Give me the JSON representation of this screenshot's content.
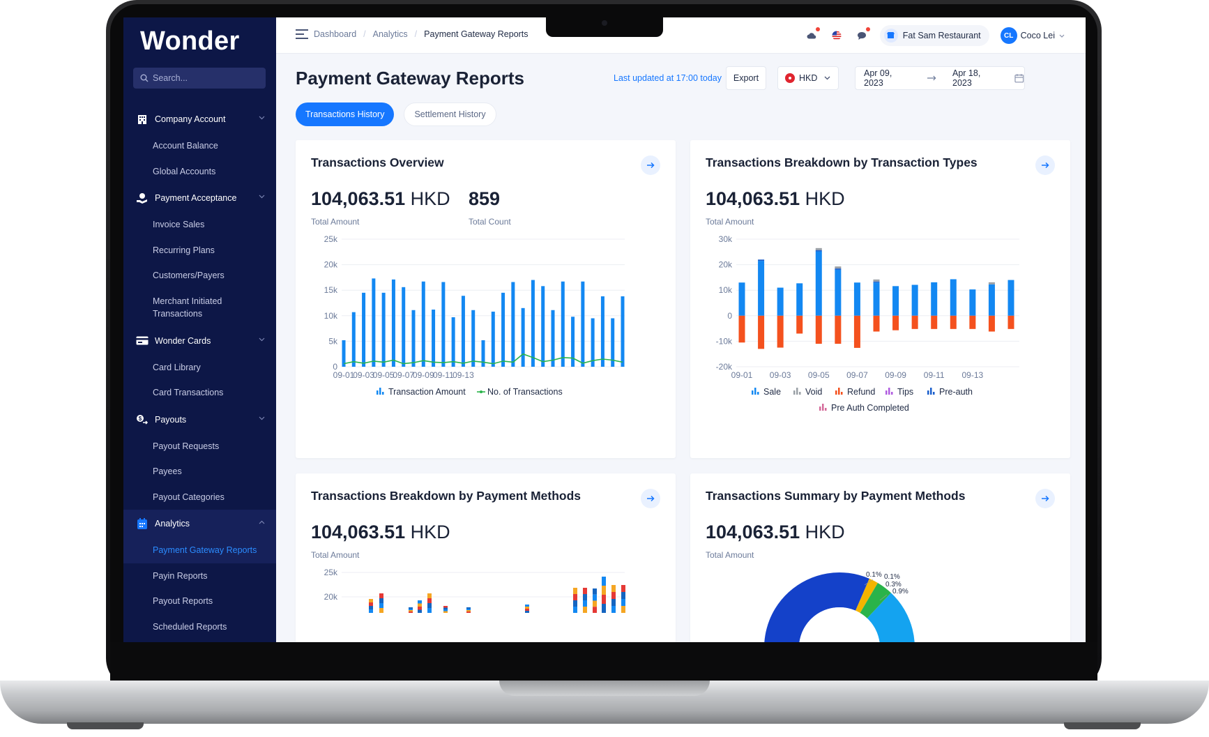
{
  "app": {
    "logo": "Wonder",
    "search_placeholder": "Search..."
  },
  "sidebar": {
    "sections": [
      {
        "label": "Company Account",
        "icon": "building-icon",
        "items": [
          "Account Balance",
          "Global Accounts"
        ]
      },
      {
        "label": "Payment Acceptance",
        "icon": "hand-payment-icon",
        "items": [
          "Invoice Sales",
          "Recurring Plans",
          "Customers/Payers",
          "Merchant Initiated Transactions"
        ]
      },
      {
        "label": "Wonder Cards",
        "icon": "card-icon",
        "items": [
          "Card Library",
          "Card Transactions"
        ]
      },
      {
        "label": "Payouts",
        "icon": "payout-icon",
        "items": [
          "Payout Requests",
          "Payees",
          "Payout Categories"
        ]
      },
      {
        "label": "Analytics",
        "icon": "analytics-icon",
        "items": [
          "Payment Gateway Reports",
          "Payin Reports",
          "Payout Reports",
          "Scheduled Reports"
        ]
      }
    ],
    "active_item": "Payment Gateway Reports"
  },
  "topbar": {
    "breadcrumbs": [
      "Dashboard",
      "Analytics",
      "Payment Gateway Reports"
    ],
    "store": "Fat Sam Restaurant",
    "user_initials": "CL",
    "user_name": "Coco Lei"
  },
  "page": {
    "title": "Payment Gateway Reports",
    "last_updated": "Last updated at 17:00 today",
    "export_label": "Export",
    "currency": "HKD",
    "date_from": "Apr 09, 2023",
    "date_to": "Apr 18, 2023",
    "tabs": [
      {
        "label": "Transactions History",
        "active": true
      },
      {
        "label": "Settlement History",
        "active": false
      }
    ]
  },
  "cards": {
    "overview": {
      "title": "Transactions Overview",
      "amount": "104,063.51",
      "currency": "HKD",
      "amount_label": "Total Amount",
      "count": "859",
      "count_label": "Total Count"
    },
    "types": {
      "title": "Transactions Breakdown by Transaction Types",
      "amount": "104,063.51",
      "currency": "HKD",
      "amount_label": "Total Amount"
    },
    "methods": {
      "title": "Transactions Breakdown by Payment Methods",
      "amount": "104,063.51",
      "currency": "HKD",
      "amount_label": "Total Amount"
    },
    "summary": {
      "title": "Transactions Summary by Payment Methods",
      "amount": "104,063.51",
      "currency": "HKD",
      "amount_label": "Total Amount"
    }
  },
  "colors": {
    "accent": "#1677ff",
    "sidebar": "#0d1747",
    "sale": "#1388f2",
    "void": "#9aa0a6",
    "refund": "#f4511e",
    "tips": "#b05ce0",
    "preauth": "#1b5fcc",
    "preauth_completed": "#d46a9a",
    "line": "#2ab34a"
  },
  "chart_data": [
    {
      "type": "bar",
      "title": "Transactions Overview",
      "x_ticks": [
        "09-01",
        "09-03",
        "09-05",
        "09-07",
        "09-09",
        "09-11",
        "09-13"
      ],
      "ylim": [
        0,
        25000
      ],
      "y_ticks": [
        "0",
        "5k",
        "10k",
        "15k",
        "20k",
        "25k"
      ],
      "series": [
        {
          "name": "Transaction Amount",
          "kind": "bar",
          "values": [
            5200,
            10700,
            14500,
            17300,
            14500,
            17100,
            15600,
            11100,
            16700,
            11200,
            16600,
            9700,
            13900,
            11100,
            5200,
            10800,
            14500,
            16600,
            11500,
            17000,
            15800,
            11100,
            16700,
            9800,
            16700,
            9500,
            13800,
            9500,
            13800
          ]
        },
        {
          "name": "No. of Transactions",
          "kind": "line",
          "values": [
            600,
            1000,
            700,
            1100,
            900,
            1300,
            600,
            800,
            1200,
            900,
            800,
            1000,
            700,
            1100,
            900,
            600,
            1100,
            900,
            2500,
            1800,
            1000,
            1300,
            1800,
            1700,
            700,
            1200,
            1500,
            1300,
            900
          ]
        }
      ],
      "legend": "bottom"
    },
    {
      "type": "bar",
      "title": "Transactions Breakdown by Transaction Types",
      "x_ticks": [
        "09-01",
        "09-03",
        "09-05",
        "09-07",
        "09-09",
        "09-11",
        "09-13"
      ],
      "ylim": [
        -20000,
        30000
      ],
      "y_ticks": [
        "-20k",
        "-10k",
        "0",
        "10k",
        "20k",
        "30k"
      ],
      "series": [
        {
          "name": "Sale",
          "values": [
            13000,
            21500,
            11000,
            12700,
            25200,
            18000,
            13000,
            13000,
            11600,
            12100,
            13100,
            14300,
            10300,
            12300,
            14000
          ]
        },
        {
          "name": "Void",
          "values": [
            0,
            0,
            0,
            0,
            800,
            800,
            0,
            800,
            0,
            0,
            0,
            0,
            0,
            800,
            0
          ]
        },
        {
          "name": "Refund",
          "values": [
            -10500,
            -13000,
            -12500,
            -7000,
            -11000,
            -11000,
            -12600,
            -6200,
            -5700,
            -5200,
            -5200,
            -5200,
            -5200,
            -6200,
            -5200
          ]
        },
        {
          "name": "Tips",
          "values": [
            0,
            0,
            0,
            0,
            0,
            0,
            0,
            0,
            0,
            0,
            0,
            0,
            0,
            0,
            0
          ]
        },
        {
          "name": "Pre-auth",
          "values": [
            0,
            500,
            0,
            0,
            500,
            500,
            0,
            400,
            0,
            0,
            0,
            0,
            0,
            0,
            0
          ]
        },
        {
          "name": "Pre Auth Completed",
          "values": [
            0,
            0,
            0,
            0,
            0,
            0,
            0,
            0,
            0,
            0,
            0,
            0,
            0,
            0,
            0
          ]
        }
      ],
      "legend": "bottom"
    },
    {
      "type": "bar",
      "title": "Transactions Breakdown by Payment Methods",
      "y_ticks_visible": [
        "20k",
        "25k"
      ],
      "note": "stacked bars, lower portion cut off"
    },
    {
      "type": "pie",
      "title": "Transactions Summary by Payment Methods",
      "slice_labels": [
        "0.1%",
        "0.1%",
        "0.3%",
        "0.9%"
      ],
      "note": "donut chart, lower portion cut off"
    }
  ]
}
